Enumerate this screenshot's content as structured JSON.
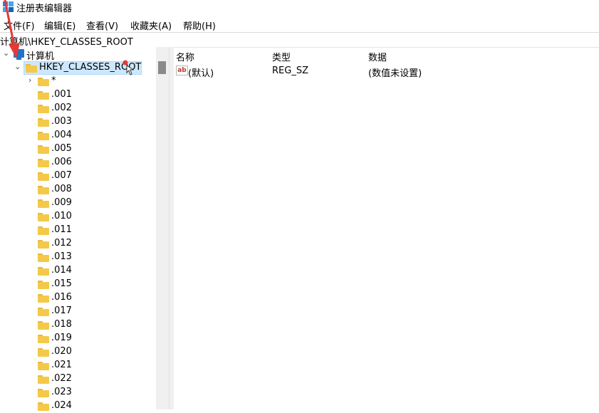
{
  "window": {
    "title": "注册表编辑器"
  },
  "menu": [
    "文件(F)",
    "编辑(E)",
    "查看(V)",
    "收藏夹(A)",
    "帮助(H)"
  ],
  "address": "计算机\\HKEY_CLASSES_ROOT",
  "tree": {
    "root_label": "计算机",
    "selected_label": "HKEY_CLASSES_ROOT",
    "star_label": "*",
    "children": [
      ".001",
      ".002",
      ".003",
      ".004",
      ".005",
      ".006",
      ".007",
      ".008",
      ".009",
      ".010",
      ".011",
      ".012",
      ".013",
      ".014",
      ".015",
      ".016",
      ".017",
      ".018",
      ".019",
      ".020",
      ".021",
      ".022",
      ".023",
      ".024"
    ]
  },
  "list": {
    "columns": [
      "名称",
      "类型",
      "数据"
    ],
    "rows": [
      {
        "name": "(默认)",
        "type": "REG_SZ",
        "data": "(数值未设置)",
        "icon": "ab"
      }
    ]
  },
  "colors": {
    "selection": "#cce8ff",
    "folder": "#f4c94a",
    "arrow": "#e53935"
  }
}
